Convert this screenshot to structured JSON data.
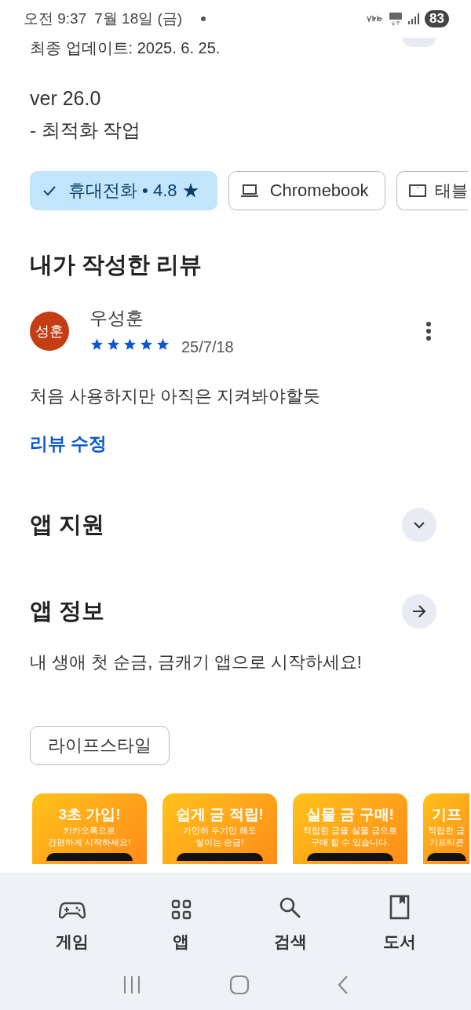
{
  "status_bar": {
    "time": "오전 9:37",
    "date": "7월 18일 (금)",
    "battery": "83"
  },
  "whats_new": {
    "updated": "최종 업데이트: 2025. 6. 25.",
    "version": "ver 26.0",
    "notes": "- 최적화 작업"
  },
  "device_chips": [
    {
      "label": "휴대전화 • 4.8 ★",
      "selected": true
    },
    {
      "label": "Chromebook",
      "selected": false,
      "kind": "laptop"
    },
    {
      "label": "태블",
      "selected": false,
      "kind": "tablet"
    }
  ],
  "my_review": {
    "heading": "내가 작성한 리뷰",
    "avatar": "성훈",
    "author": "우성훈",
    "stars": 5,
    "date": "25/7/18",
    "text": "처음 사용하지만 아직은 지켜봐야할듯",
    "edit_link": "리뷰 수정"
  },
  "sections": [
    {
      "title": "앱 지원",
      "kind": "expand"
    },
    {
      "title": "앱 정보",
      "kind": "navigate"
    }
  ],
  "app_description": "내 생애 첫 순금, 금캐기 앱으로 시작하세요!",
  "tags": [
    "라이프스타일"
  ],
  "screenshots": [
    {
      "title": "3초 가입!",
      "lines": [
        "카카오톡으로",
        "간편하게 시작하세요!"
      ]
    },
    {
      "title": "쉽게 금 적립!",
      "lines": [
        "가만히 두기만 해도",
        "쌓이는 순금!"
      ]
    },
    {
      "title": "실물 금 구매!",
      "lines": [
        "적립한 금을 실물 금으로",
        "구매 할 수 있습니다."
      ]
    },
    {
      "title": "기프",
      "lines": [
        "적립한 금",
        "기프티콘"
      ]
    }
  ],
  "bottom_nav": [
    {
      "label": "게임",
      "kind": "games"
    },
    {
      "label": "앱",
      "kind": "apps"
    },
    {
      "label": "검색",
      "kind": "search"
    },
    {
      "label": "도서",
      "kind": "books"
    }
  ]
}
